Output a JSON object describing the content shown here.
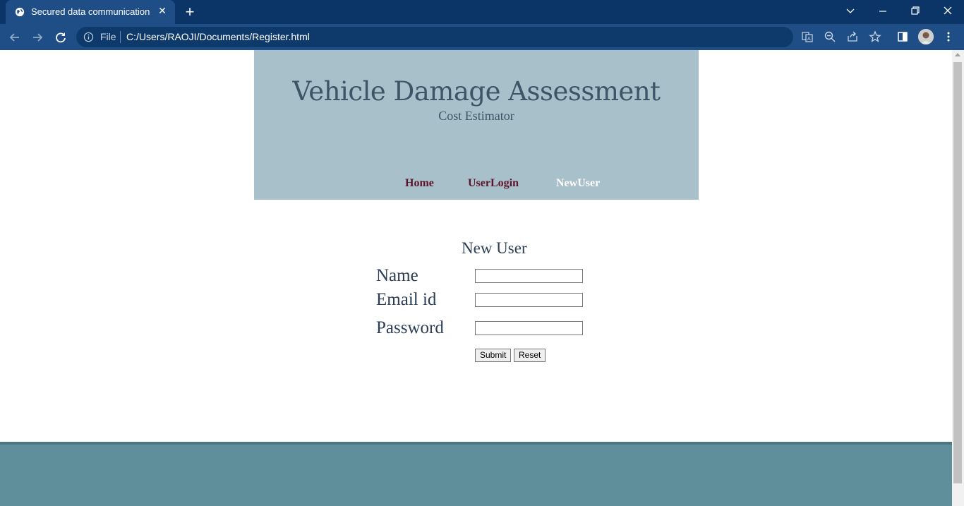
{
  "browser": {
    "tab_title": "Secured data communication",
    "scheme_label": "File",
    "url": "C:/Users/RAOJI/Documents/Register.html"
  },
  "header": {
    "title": "Vehicle Damage Assessment",
    "subtitle": "Cost Estimator",
    "nav": [
      {
        "label": "Home",
        "active": false
      },
      {
        "label": "UserLogin",
        "active": false
      },
      {
        "label": "NewUser",
        "active": true
      }
    ]
  },
  "form": {
    "title": "New User",
    "fields": [
      {
        "label": "Name",
        "value": ""
      },
      {
        "label": "Email id",
        "value": ""
      },
      {
        "label": "Password",
        "value": ""
      }
    ],
    "submit_label": "Submit",
    "reset_label": "Reset"
  },
  "colors": {
    "header_bg": "#a7c0c9",
    "title_text": "#3e5468",
    "nav_link": "#5e1529",
    "nav_active": "#ffffff",
    "footer_bg": "#608f9c",
    "chrome_bg": "#0b3566"
  }
}
